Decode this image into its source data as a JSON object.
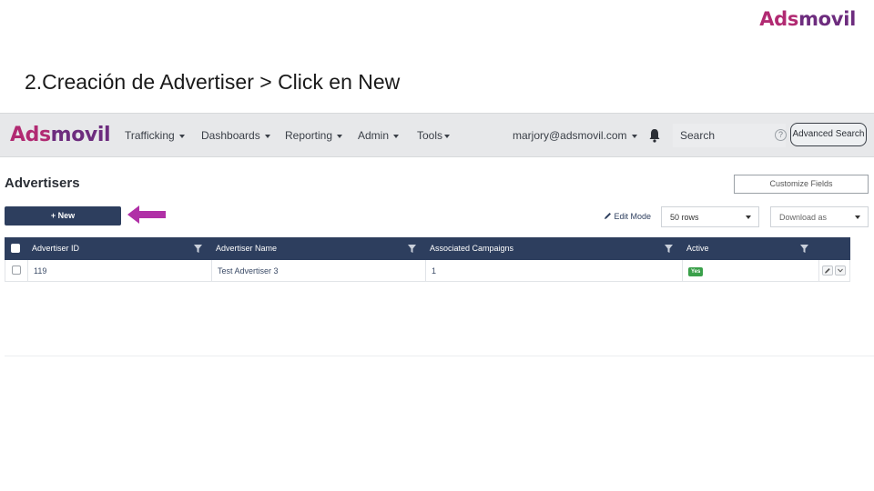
{
  "slide": {
    "logo_part1": "Ads",
    "logo_part2": "movil",
    "title": "2.Creación de Advertiser > Click en New"
  },
  "navbar": {
    "logo_part1": "Ads",
    "logo_part2": "movil",
    "items": [
      "Trafficking",
      "Dashboards",
      "Reporting",
      "Admin",
      "Tools"
    ],
    "user_email": "marjory@adsmovil.com",
    "search_placeholder": "Search",
    "help_symbol": "?",
    "advanced_search_label": "Advanced Search",
    "icons": [
      "bell-icon",
      "help-icon"
    ]
  },
  "page": {
    "heading": "Advertisers",
    "customize_fields_label": "Customize Fields",
    "new_button_label": "+ New",
    "edit_mode_label": "Edit Mode",
    "rows_select_value": "50 rows",
    "download_select_value": "Download as",
    "highlight_arrow_color": "#b030a6"
  },
  "table": {
    "columns": [
      "Advertiser ID",
      "Advertiser Name",
      "Associated Campaigns",
      "Active"
    ],
    "rows": [
      {
        "id": "119",
        "name": "Test Advertiser 3",
        "campaigns": "1",
        "active": "Yes"
      }
    ]
  },
  "colors": {
    "brand_pink": "#b12a72",
    "brand_purple": "#6d2c7e",
    "header_navy": "#2d3e5e",
    "active_green": "#3aa04a"
  }
}
